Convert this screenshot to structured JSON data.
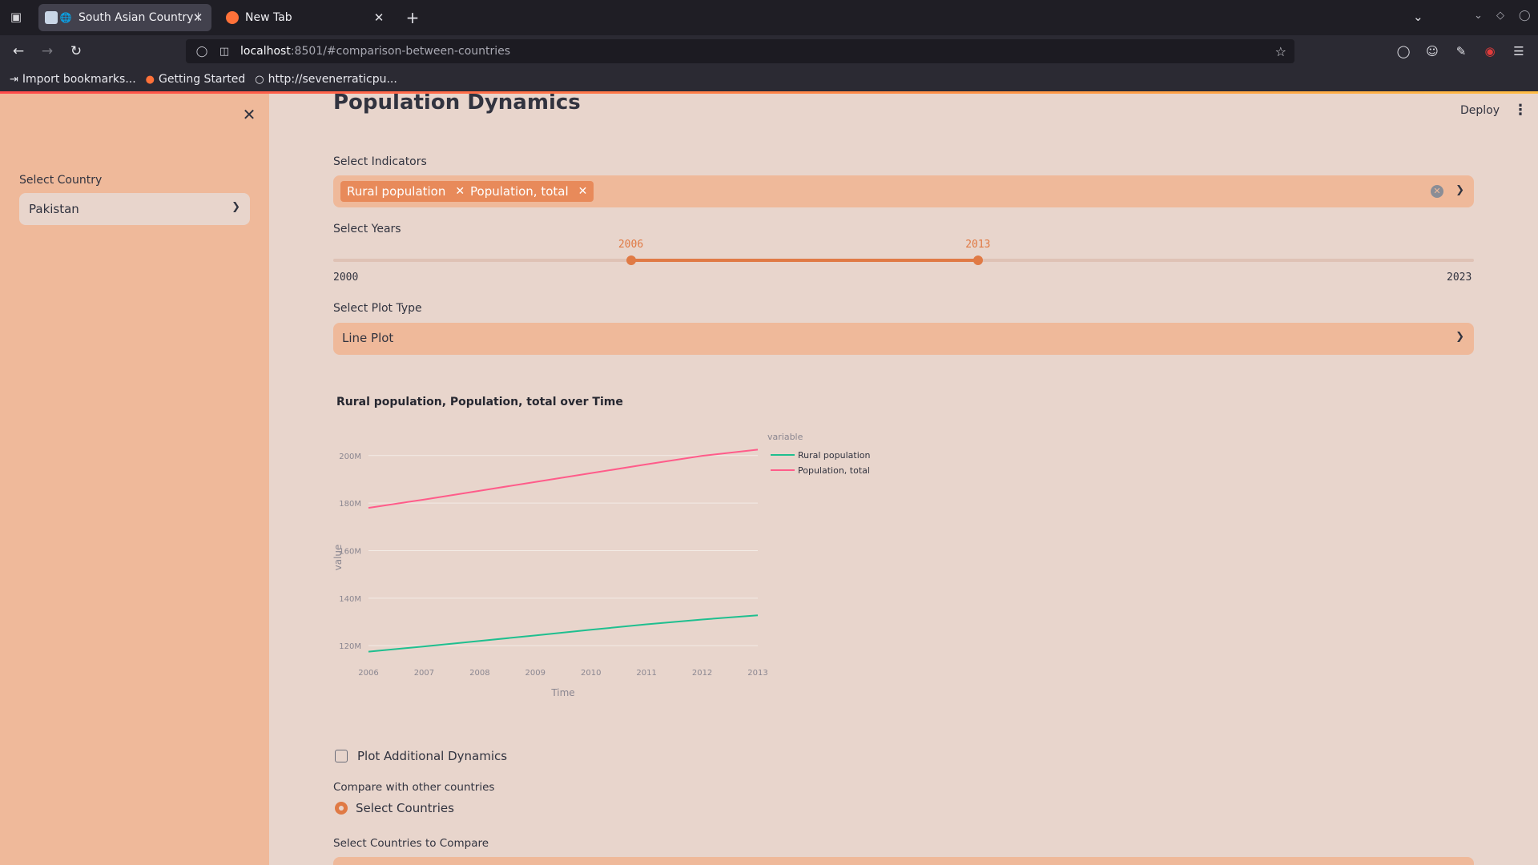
{
  "browser": {
    "tabs": [
      {
        "title": "South Asian Country Ex",
        "active": true
      },
      {
        "title": "New Tab",
        "active": false
      }
    ],
    "url_host": "localhost",
    "url_rest": ":8501/#comparison-between-countries",
    "bookmarks": [
      "Import bookmarks...",
      "Getting Started",
      "http://sevenerraticpu..."
    ]
  },
  "sidebar": {
    "country_label": "Select Country",
    "country_value": "Pakistan"
  },
  "header": {
    "deploy_label": "Deploy"
  },
  "main": {
    "section_title": "Population Dynamics",
    "indicators_label": "Select Indicators",
    "indicators": [
      "Rural population",
      "Population, total"
    ],
    "years_label": "Select Years",
    "year_min": "2000",
    "year_max": "2023",
    "year_start": "2006",
    "year_end": "2013",
    "year_range_fraction": [
      0.2609,
      0.5652
    ],
    "plot_type_label": "Select Plot Type",
    "plot_type_value": "Line Plot",
    "additional_label": "Plot Additional Dynamics",
    "compare_label": "Compare with other countries",
    "compare_option": "Select Countries",
    "compare_select_label": "Select Countries to Compare"
  },
  "colors": {
    "sidebar_bg": "#efb99a",
    "main_bg": "#e8d5cc",
    "accent": "#e07a45",
    "rural_line": "#1fbf8f",
    "total_line": "#ff5c8a"
  },
  "chart_data": {
    "type": "line",
    "title": "Rural population, Population, total over Time",
    "xlabel": "Time",
    "ylabel": "value",
    "legend_title": "variable",
    "legend_position": "top-right",
    "x": [
      2006,
      2007,
      2008,
      2009,
      2010,
      2011,
      2012,
      2013
    ],
    "x_tick_labels": [
      "2006",
      "2007",
      "2008",
      "2009",
      "2010",
      "2011",
      "2012",
      "2013"
    ],
    "y_ticks": [
      120000000,
      140000000,
      160000000,
      180000000,
      200000000
    ],
    "y_tick_labels": [
      "120M",
      "140M",
      "160M",
      "180M",
      "200M"
    ],
    "ylim": [
      115000000,
      206000000
    ],
    "grid": true,
    "series": [
      {
        "name": "Rural population",
        "color": "#1fbf8f",
        "values": [
          117500000,
          119700000,
          122000000,
          124300000,
          126700000,
          129000000,
          131000000,
          132800000
        ]
      },
      {
        "name": "Population, total",
        "color": "#ff5c8a",
        "values": [
          178000000,
          181500000,
          185200000,
          188900000,
          192600000,
          196300000,
          199900000,
          202500000
        ]
      }
    ]
  }
}
